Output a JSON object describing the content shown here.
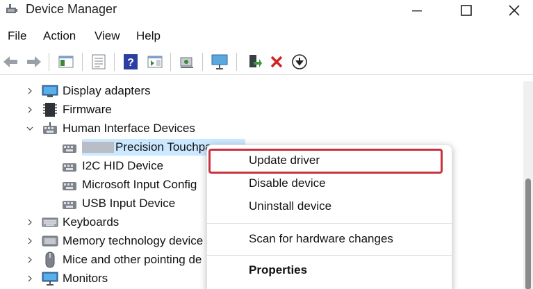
{
  "window": {
    "title": "Device Manager",
    "icon": "device-manager-icon"
  },
  "menu": {
    "items": [
      "File",
      "Action",
      "View",
      "Help"
    ]
  },
  "toolbar": {
    "icons": [
      "back-arrow-icon",
      "forward-arrow-icon",
      "show-hide-console-tree-icon",
      "properties-icon",
      "help-icon",
      "action-pane-icon",
      "scan-hardware-icon",
      "monitor-icon",
      "update-driver-icon",
      "uninstall-icon",
      "download-driver-icon"
    ]
  },
  "tree": {
    "rows": [
      {
        "label": "Display adapters",
        "state": "collapsed",
        "icon": "display-adapter-icon"
      },
      {
        "label": "Firmware",
        "state": "collapsed",
        "icon": "firmware-icon"
      },
      {
        "label": "Human Interface Devices",
        "state": "expanded",
        "icon": "hid-icon"
      },
      {
        "label": "Precision Touchpa",
        "state": "child-selected",
        "icon": "hid-device-icon"
      },
      {
        "label": "I2C HID Device",
        "state": "child",
        "icon": "hid-device-icon"
      },
      {
        "label": "Microsoft Input Config",
        "state": "child",
        "icon": "hid-device-icon"
      },
      {
        "label": "USB Input Device",
        "state": "child",
        "icon": "hid-device-icon"
      },
      {
        "label": "Keyboards",
        "state": "collapsed",
        "icon": "keyboard-icon"
      },
      {
        "label": "Memory technology device",
        "state": "collapsed",
        "icon": "memory-icon"
      },
      {
        "label": "Mice and other pointing de",
        "state": "collapsed",
        "icon": "mouse-icon"
      },
      {
        "label": "Monitors",
        "state": "collapsed",
        "icon": "monitor-device-icon"
      }
    ]
  },
  "context_menu": {
    "items": [
      {
        "label": "Update driver",
        "highlighted": true
      },
      {
        "label": "Disable device"
      },
      {
        "label": "Uninstall device"
      },
      {
        "label": "Scan for hardware changes"
      },
      {
        "label": "Properties",
        "bold": true
      }
    ],
    "highlight_color": "#c9333f"
  },
  "colors": {
    "selection": "#cce8ff",
    "highlight_border": "#c9333f",
    "uninstall_red": "#d42020",
    "help_blue": "#2a3fa0"
  }
}
